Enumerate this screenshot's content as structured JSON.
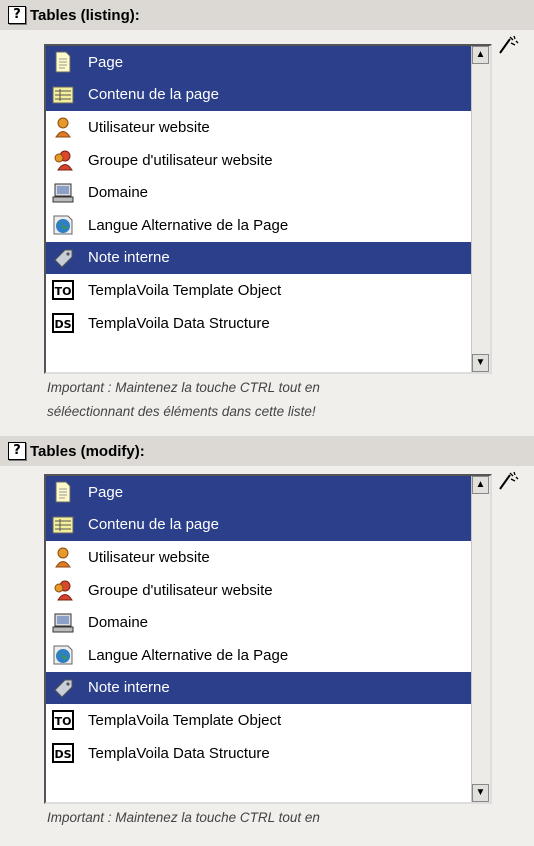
{
  "sections": [
    {
      "help_label": "?",
      "title": "Tables (listing):",
      "items": [
        {
          "label": "Page",
          "icon": "page-icon",
          "selected": true
        },
        {
          "label": "Contenu de la page",
          "icon": "content-icon",
          "selected": true
        },
        {
          "label": "Utilisateur website",
          "icon": "user-icon",
          "selected": false
        },
        {
          "label": "Groupe d'utilisateur website",
          "icon": "usergroup-icon",
          "selected": false
        },
        {
          "label": "Domaine",
          "icon": "domain-icon",
          "selected": false
        },
        {
          "label": "Langue Alternative de la Page",
          "icon": "language-icon",
          "selected": false
        },
        {
          "label": "Note interne",
          "icon": "note-icon",
          "selected": true
        },
        {
          "label": "TemplaVoila Template Object",
          "icon": "to-icon",
          "selected": false
        },
        {
          "label": "TemplaVoila Data Structure",
          "icon": "ds-icon",
          "selected": false
        }
      ],
      "note_line1": "Important : Maintenez la touche CTRL tout en",
      "note_line2": "séléectionnant des éléments dans cette liste!"
    },
    {
      "help_label": "?",
      "title": "Tables (modify):",
      "items": [
        {
          "label": "Page",
          "icon": "page-icon",
          "selected": true
        },
        {
          "label": "Contenu de la page",
          "icon": "content-icon",
          "selected": true
        },
        {
          "label": "Utilisateur website",
          "icon": "user-icon",
          "selected": false
        },
        {
          "label": "Groupe d'utilisateur website",
          "icon": "usergroup-icon",
          "selected": false
        },
        {
          "label": "Domaine",
          "icon": "domain-icon",
          "selected": false
        },
        {
          "label": "Langue Alternative de la Page",
          "icon": "language-icon",
          "selected": false
        },
        {
          "label": "Note interne",
          "icon": "note-icon",
          "selected": true
        },
        {
          "label": "TemplaVoila Template Object",
          "icon": "to-icon",
          "selected": false
        },
        {
          "label": "TemplaVoila Data Structure",
          "icon": "ds-icon",
          "selected": false
        }
      ],
      "note_line1": "Important : Maintenez la touche CTRL tout en",
      "note_line2": ""
    }
  ],
  "colors": {
    "selection": "#2b3f8a",
    "header_bg": "#dcd9d4",
    "panel_bg": "#f0efec"
  },
  "scroll": {
    "up_glyph": "▲",
    "down_glyph": "▼"
  },
  "icon_text": {
    "to": "TO",
    "ds": "DS"
  }
}
